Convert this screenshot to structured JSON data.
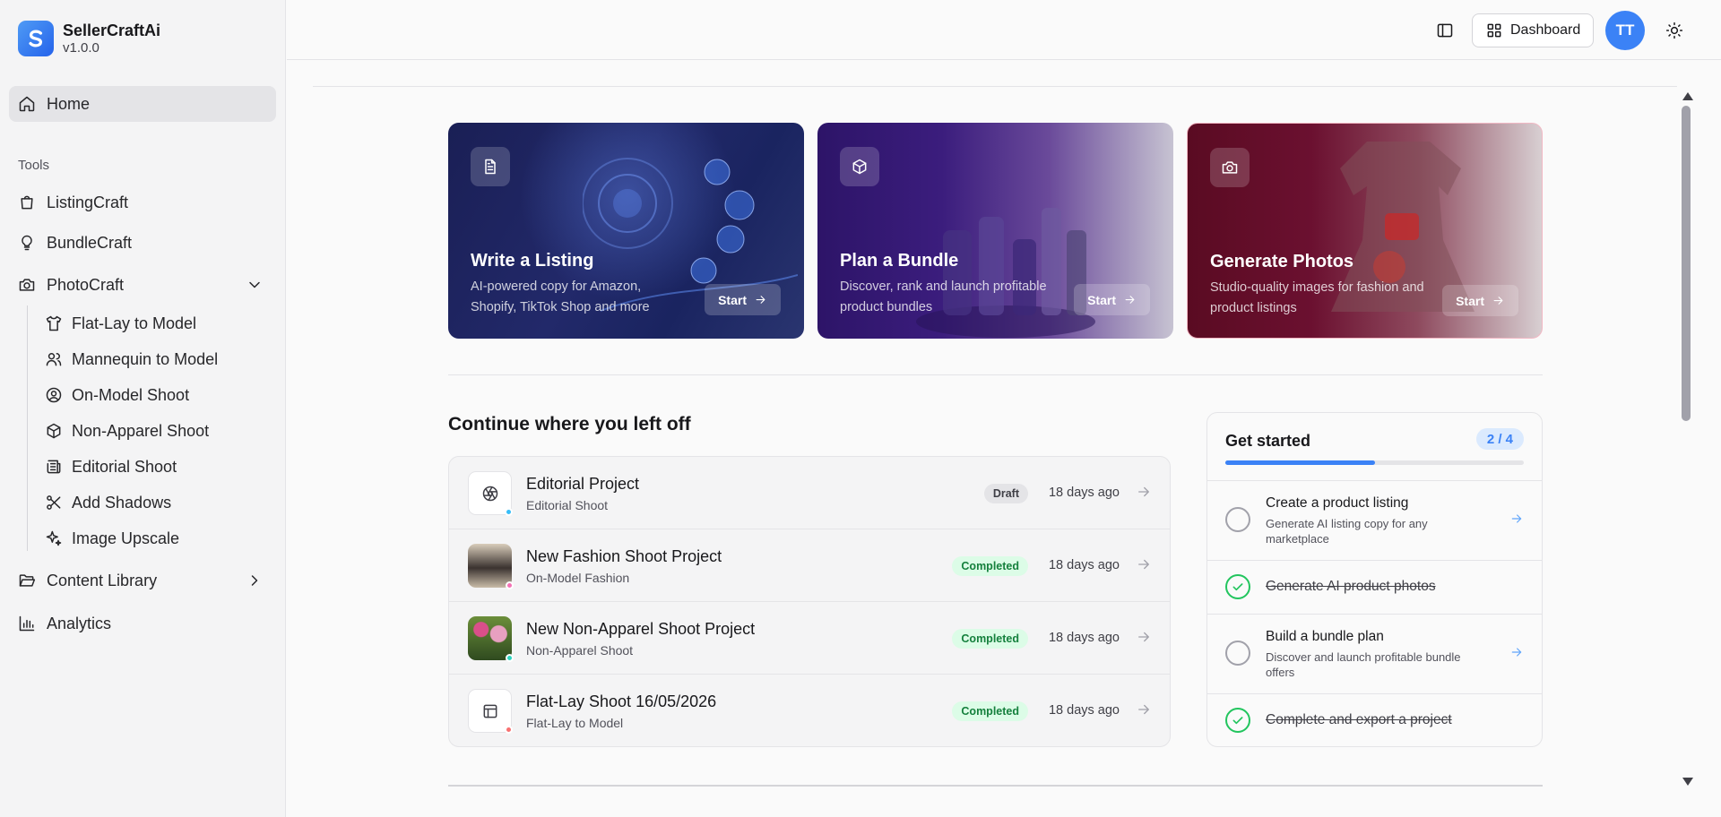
{
  "brand": {
    "name": "SellerCraftAi",
    "version": "v1.0.0"
  },
  "sidebar": {
    "home": "Home",
    "tools_label": "Tools",
    "items": [
      {
        "label": "ListingCraft"
      },
      {
        "label": "BundleCraft"
      },
      {
        "label": "PhotoCraft"
      }
    ],
    "photocraft_sub": [
      {
        "label": "Flat-Lay to Model"
      },
      {
        "label": "Mannequin to Model"
      },
      {
        "label": "On-Model Shoot"
      },
      {
        "label": "Non-Apparel Shoot"
      },
      {
        "label": "Editorial Shoot"
      },
      {
        "label": "Add Shadows"
      },
      {
        "label": "Image Upscale"
      }
    ],
    "content_library": "Content Library",
    "analytics": "Analytics"
  },
  "header": {
    "dashboard_label": "Dashboard",
    "avatar_initials": "TT"
  },
  "hero_cards": [
    {
      "title": "Write a Listing",
      "desc": "AI-powered copy for Amazon, Shopify, TikTok Shop and more",
      "cta": "Start"
    },
    {
      "title": "Plan a Bundle",
      "desc": "Discover, rank and launch profitable product bundles",
      "cta": "Start"
    },
    {
      "title": "Generate Photos",
      "desc": "Studio-quality images for fashion and product listings",
      "cta": "Start"
    }
  ],
  "continue": {
    "title": "Continue where you left off",
    "projects": [
      {
        "title": "Editorial Project",
        "sub": "Editorial Shoot",
        "status": "Draft",
        "time": "18 days ago"
      },
      {
        "title": "New Fashion Shoot Project",
        "sub": "On-Model Fashion",
        "status": "Completed",
        "time": "18 days ago"
      },
      {
        "title": "New Non-Apparel Shoot Project",
        "sub": "Non-Apparel Shoot",
        "status": "Completed",
        "time": "18 days ago"
      },
      {
        "title": "Flat-Lay Shoot 16/05/2026",
        "sub": "Flat-Lay to Model",
        "status": "Completed",
        "time": "18 days ago"
      }
    ]
  },
  "get_started": {
    "title": "Get started",
    "count": "2 / 4",
    "progress_fraction": 0.5,
    "steps": [
      {
        "title": "Create a product listing",
        "desc": "Generate AI listing copy for any marketplace",
        "done": false
      },
      {
        "title": "Generate AI product photos",
        "done": true
      },
      {
        "title": "Build a bundle plan",
        "desc": "Discover and launch profitable bundle offers",
        "done": false
      },
      {
        "title": "Complete and export a project",
        "done": true
      }
    ]
  },
  "colors": {
    "accent": "#3b82f6",
    "success": "#22c55e"
  }
}
